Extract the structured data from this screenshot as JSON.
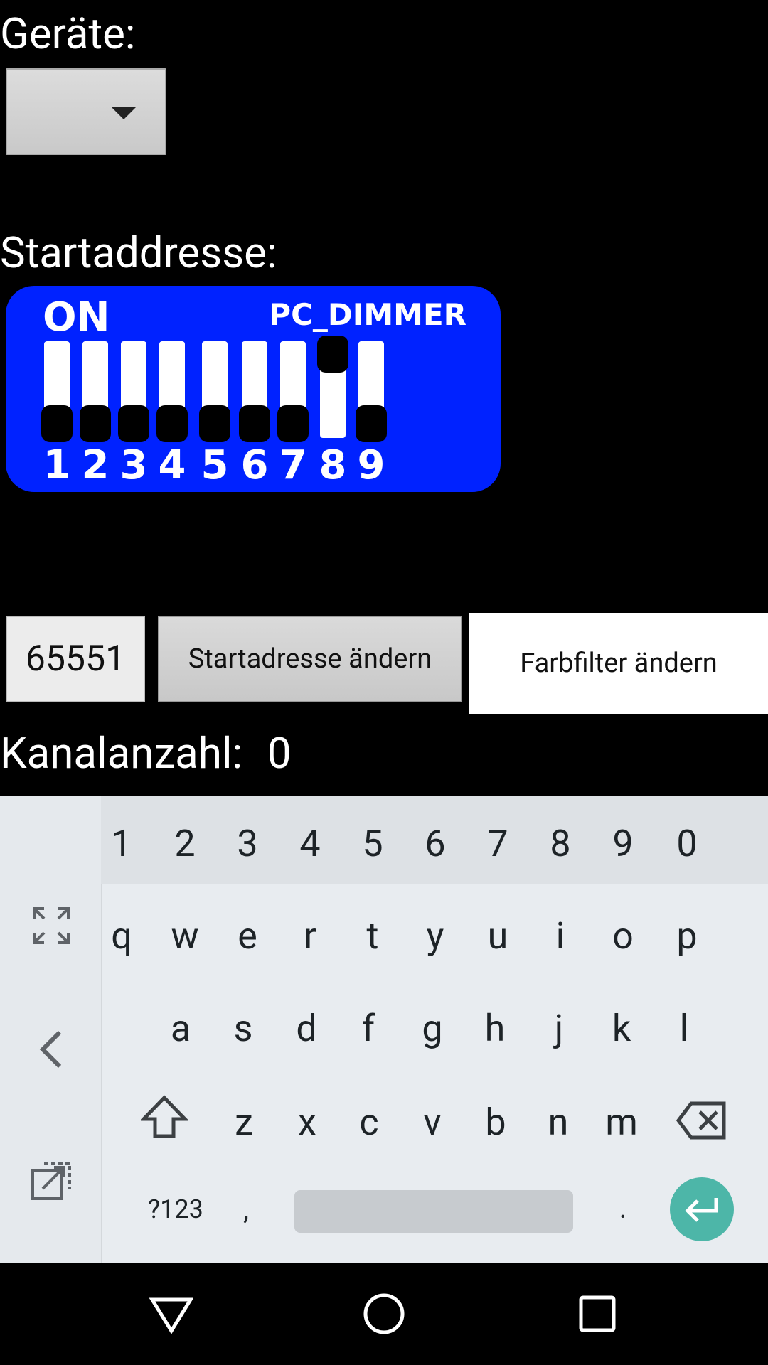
{
  "labels": {
    "devices": "Geräte:",
    "start_address": "Startaddresse:",
    "channel_count_label": "Kanalanzahl:",
    "channel_count_value": "0"
  },
  "dip": {
    "on_text": "ON",
    "brand": "PC_DIMMER",
    "switches": [
      {
        "num": "1",
        "on": false
      },
      {
        "num": "2",
        "on": false
      },
      {
        "num": "3",
        "on": false
      },
      {
        "num": "4",
        "on": false
      },
      {
        "num": "5",
        "on": false
      },
      {
        "num": "6",
        "on": false
      },
      {
        "num": "7",
        "on": false
      },
      {
        "num": "8",
        "on": true
      },
      {
        "num": "9",
        "on": false
      }
    ]
  },
  "actions": {
    "address_value": "65551",
    "start_button": "Startadresse ändern",
    "filter_button": "Farbfilter ändern"
  },
  "keyboard": {
    "numrow": [
      "1",
      "2",
      "3",
      "4",
      "5",
      "6",
      "7",
      "8",
      "9",
      "0"
    ],
    "row1": [
      "q",
      "w",
      "e",
      "r",
      "t",
      "y",
      "u",
      "i",
      "o",
      "p"
    ],
    "row2": [
      "a",
      "s",
      "d",
      "f",
      "g",
      "h",
      "j",
      "k",
      "l"
    ],
    "row3": [
      "z",
      "x",
      "c",
      "v",
      "b",
      "n",
      "m"
    ],
    "symbols_key": "?123",
    "comma_key": ",",
    "period_key": ".",
    "enter_color": "#4db6a8"
  }
}
